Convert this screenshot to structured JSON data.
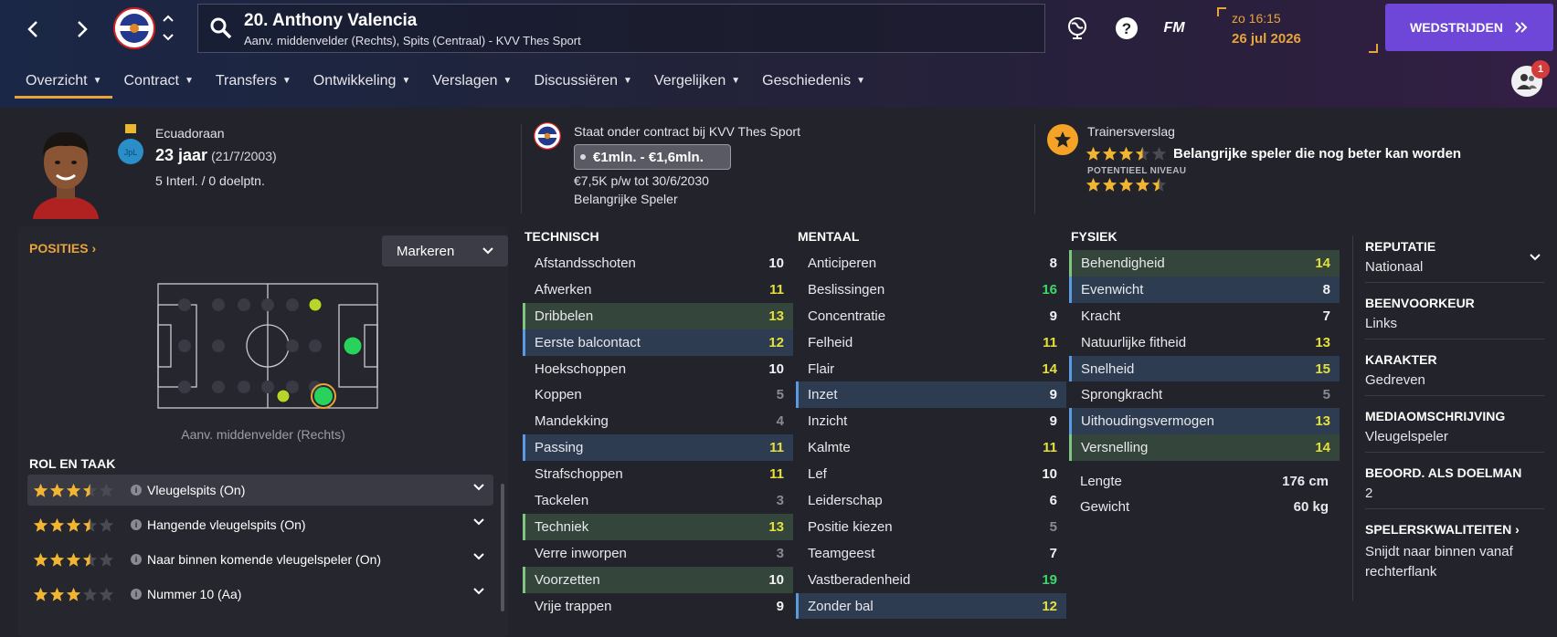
{
  "topbar": {
    "player_title": "20. Anthony Valencia",
    "player_subtitle": "Aanv. middenvelder (Rechts), Spits (Centraal) - KVV Thes Sport",
    "fm_label": "FM",
    "time": "zo 16:15",
    "date": "26 jul 2026",
    "continue_label": "WEDSTRIJDEN",
    "notification_count": "1"
  },
  "tabs": [
    {
      "label": "Overzicht"
    },
    {
      "label": "Contract"
    },
    {
      "label": "Transfers"
    },
    {
      "label": "Ontwikkeling"
    },
    {
      "label": "Verslagen"
    },
    {
      "label": "Discussiëren"
    },
    {
      "label": "Vergelijken"
    },
    {
      "label": "Geschiedenis"
    }
  ],
  "header": {
    "nationality": "Ecuadoraan",
    "flag_text": "JpL",
    "age": "23 jaar",
    "birthdate": "(21/7/2003)",
    "caps": "5 Interl. / 0 doelptn.",
    "contract_title": "Staat onder contract bij KVV Thes Sport",
    "value": "€1mln. - €1,6mln.",
    "wage": "€7,5K p/w tot 30/6/2030",
    "squad_status": "Belangrijke Speler",
    "coach_title": "Trainersverslag",
    "ability_stars": 3.5,
    "coach_verdict": "Belangrijke speler die nog beter kan worden",
    "potential_label": "POTENTIEEL NIVEAU",
    "potential_stars": 4.5
  },
  "positions": {
    "title": "POSITIES",
    "mark_button": "Markeren",
    "position_label": "Aanv. middenvelder (Rechts)"
  },
  "roles": {
    "title": "ROL EN TAAK",
    "items": [
      {
        "name": "Vleugelspits (On)",
        "stars": 3.5
      },
      {
        "name": "Hangende vleugelspits (On)",
        "stars": 3.5
      },
      {
        "name": "Naar binnen komende vleugelspeler (On)",
        "stars": 3.5
      },
      {
        "name": "Nummer 10 (Aa)",
        "stars": 3
      }
    ]
  },
  "technical": {
    "title": "TECHNISCH",
    "rows": [
      {
        "name": "Afstandsschoten",
        "value": "10",
        "hl": ""
      },
      {
        "name": "Afwerken",
        "value": "11",
        "hl": ""
      },
      {
        "name": "Dribbelen",
        "value": "13",
        "hl": "green"
      },
      {
        "name": "Eerste balcontact",
        "value": "12",
        "hl": "blue"
      },
      {
        "name": "Hoekschoppen",
        "value": "10",
        "hl": ""
      },
      {
        "name": "Koppen",
        "value": "5",
        "hl": ""
      },
      {
        "name": "Mandekking",
        "value": "4",
        "hl": ""
      },
      {
        "name": "Passing",
        "value": "11",
        "hl": "blue"
      },
      {
        "name": "Strafschoppen",
        "value": "11",
        "hl": ""
      },
      {
        "name": "Tackelen",
        "value": "3",
        "hl": ""
      },
      {
        "name": "Techniek",
        "value": "13",
        "hl": "green"
      },
      {
        "name": "Verre inworpen",
        "value": "3",
        "hl": ""
      },
      {
        "name": "Voorzetten",
        "value": "10",
        "hl": "green"
      },
      {
        "name": "Vrije trappen",
        "value": "9",
        "hl": ""
      }
    ]
  },
  "mental": {
    "title": "MENTAAL",
    "rows": [
      {
        "name": "Anticiperen",
        "value": "8",
        "hl": ""
      },
      {
        "name": "Beslissingen",
        "value": "16",
        "hl": ""
      },
      {
        "name": "Concentratie",
        "value": "9",
        "hl": ""
      },
      {
        "name": "Felheid",
        "value": "11",
        "hl": ""
      },
      {
        "name": "Flair",
        "value": "14",
        "hl": ""
      },
      {
        "name": "Inzet",
        "value": "9",
        "hl": "blue"
      },
      {
        "name": "Inzicht",
        "value": "9",
        "hl": ""
      },
      {
        "name": "Kalmte",
        "value": "11",
        "hl": ""
      },
      {
        "name": "Lef",
        "value": "10",
        "hl": ""
      },
      {
        "name": "Leiderschap",
        "value": "6",
        "hl": ""
      },
      {
        "name": "Positie kiezen",
        "value": "5",
        "hl": ""
      },
      {
        "name": "Teamgeest",
        "value": "7",
        "hl": ""
      },
      {
        "name": "Vastberadenheid",
        "value": "19",
        "hl": ""
      },
      {
        "name": "Zonder bal",
        "value": "12",
        "hl": "blue"
      }
    ]
  },
  "physical": {
    "title": "FYSIEK",
    "rows": [
      {
        "name": "Behendigheid",
        "value": "14",
        "hl": "green"
      },
      {
        "name": "Evenwicht",
        "value": "8",
        "hl": "blue"
      },
      {
        "name": "Kracht",
        "value": "7",
        "hl": ""
      },
      {
        "name": "Natuurlijke fitheid",
        "value": "13",
        "hl": ""
      },
      {
        "name": "Snelheid",
        "value": "15",
        "hl": "blue"
      },
      {
        "name": "Sprongkracht",
        "value": "5",
        "hl": ""
      },
      {
        "name": "Uithoudingsvermogen",
        "value": "13",
        "hl": "blue"
      },
      {
        "name": "Versnelling",
        "value": "14",
        "hl": "green"
      }
    ],
    "height_label": "Lengte",
    "height_value": "176 cm",
    "weight_label": "Gewicht",
    "weight_value": "60 kg"
  },
  "info": {
    "reputation_title": "REPUTATIE",
    "reputation_value": "Nationaal",
    "foot_title": "BEENVOORKEUR",
    "foot_value": "Links",
    "personality_title": "KARAKTER",
    "personality_value": "Gedreven",
    "media_title": "MEDIAOMSCHRIJVING",
    "media_value": "Vleugelspeler",
    "gk_title": "BEOORD. ALS DOELMAN",
    "gk_value": "2",
    "traits_title": "SPELERSKWALITEITEN",
    "traits_value": "Snijdt naar binnen vanaf rechterflank"
  },
  "colors": {
    "accent": "#e8a33a",
    "button": "#6e47d8",
    "value_white": "#f2f2f4",
    "value_yellow": "#e5e03a",
    "value_green": "#3ed76a",
    "value_grey": "#8a8a94"
  }
}
